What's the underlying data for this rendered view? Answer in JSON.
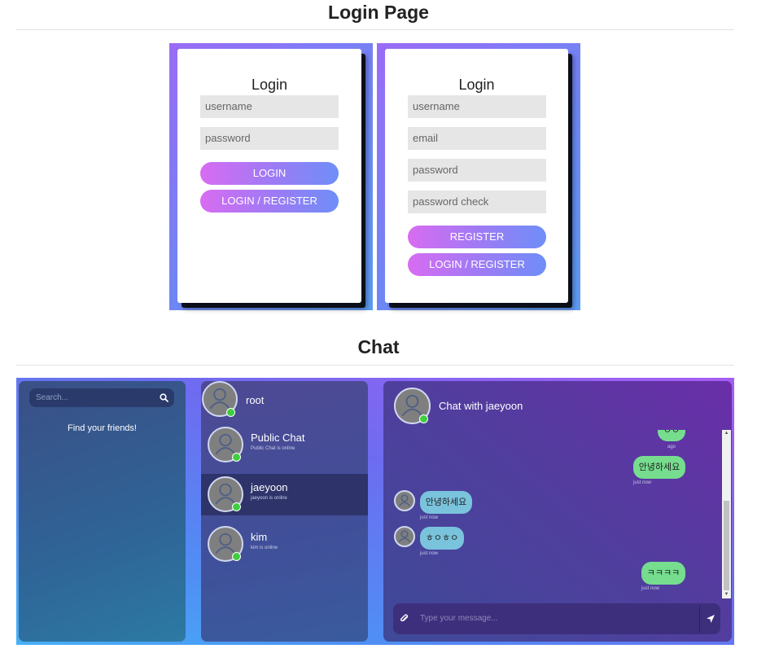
{
  "login_section": {
    "title": "Login Page",
    "login_card": {
      "heading": "Login",
      "username_placeholder": "username",
      "password_placeholder": "password",
      "login_button": "LOGIN",
      "toggle_button": "LOGIN / REGISTER"
    },
    "register_card": {
      "heading": "Login",
      "username_placeholder": "username",
      "email_placeholder": "email",
      "password_placeholder": "password",
      "password_check_placeholder": "password check",
      "register_button": "REGISTER",
      "toggle_button": "LOGIN / REGISTER"
    }
  },
  "chat_section": {
    "title": "Chat",
    "search": {
      "placeholder": "Search...",
      "icon": "search-icon"
    },
    "find_friends_text": "Find your friends!",
    "current_user": {
      "name": "root"
    },
    "contacts": [
      {
        "name": "Public Chat",
        "status": "Public Chat is online",
        "online": true
      },
      {
        "name": "jaeyoon",
        "status": "jaeyoon is online",
        "online": true,
        "active": true
      },
      {
        "name": "kim",
        "status": "kim is online",
        "online": true
      }
    ],
    "header": {
      "title": "Chat with jaeyoon"
    },
    "messages": [
      {
        "direction": "out",
        "text": "ㅇㅇ",
        "time": "ago"
      },
      {
        "direction": "out",
        "text": "안녕하세요",
        "time": "just now"
      },
      {
        "direction": "in",
        "text": "안녕하세요",
        "time": "just now"
      },
      {
        "direction": "in",
        "text": "ㅎㅇㅎㅇ",
        "time": "just now"
      },
      {
        "direction": "out",
        "text": "ㅋㅋㅋㅋ",
        "time": "just now"
      }
    ],
    "composer": {
      "placeholder": "Type your message...",
      "attach_icon": "paperclip-icon",
      "send_icon": "send-icon"
    },
    "colors": {
      "online": "#3fce3f",
      "outgoing_bubble": "#76dd8f",
      "incoming_bubble": "#7ac3dc",
      "active_contact": "#2e346a"
    }
  }
}
